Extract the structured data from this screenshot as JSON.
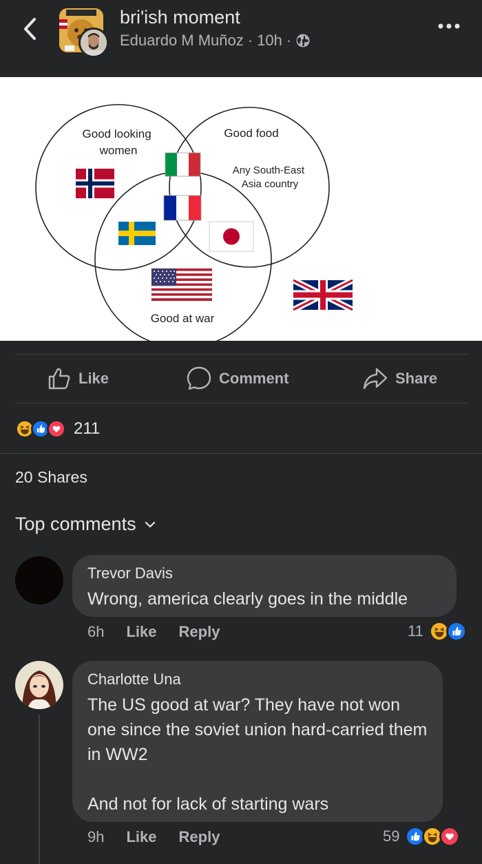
{
  "header": {
    "group_name": "bri'ish moment",
    "author": "Eduardo M Muñoz",
    "separator": "·",
    "time": "10h",
    "privacy_icon": "globe-icon",
    "back_icon": "chevron-left-icon",
    "more_icon": "more-dots-icon"
  },
  "post_image": {
    "circles": [
      "Good looking\nwomen",
      "Good food",
      "Good at war"
    ],
    "annotation": "Any South-East\nAsia country",
    "flags": [
      "norway",
      "italy",
      "france",
      "sweden",
      "japan",
      "usa",
      "uk"
    ]
  },
  "actions": {
    "like": "Like",
    "comment": "Comment",
    "share": "Share"
  },
  "reactions": {
    "count": "211",
    "types": [
      "haha",
      "like",
      "love"
    ]
  },
  "shares_text": "20 Shares",
  "top_comments_label": "Top comments",
  "comments": [
    {
      "name": "Trevor Davis",
      "text": "Wrong, america clearly goes in the middle",
      "time": "6h",
      "like_label": "Like",
      "reply_label": "Reply",
      "reaction_count": "11",
      "reaction_types": [
        "haha",
        "like"
      ]
    },
    {
      "name": "Charlotte Una",
      "text": "The US good at war? They have not won one since the soviet union hard-carried them in WW2\n\nAnd not for lack of starting wars",
      "time": "9h",
      "like_label": "Like",
      "reply_label": "Reply",
      "reaction_count": "59",
      "reaction_types": [
        "like",
        "haha",
        "love"
      ]
    }
  ],
  "colors": {
    "background": "#242526",
    "bubble": "#3a3b3c",
    "text_primary": "#e4e6eb",
    "text_secondary": "#b0b3b8",
    "like_blue": "#1877f2",
    "love_red": "#f33e58",
    "haha_yellow": "#f7b125"
  }
}
